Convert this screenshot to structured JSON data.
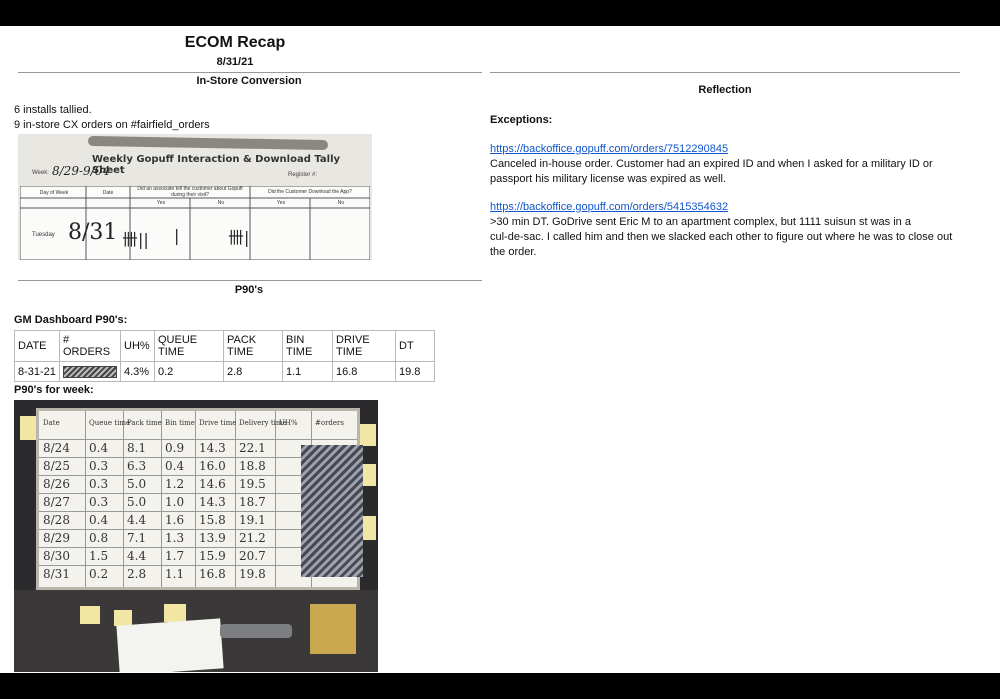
{
  "header": {
    "title": "ECOM Recap",
    "date": "8/31/21"
  },
  "in_store": {
    "heading": "In-Store Conversion",
    "lines": [
      "6 installs tallied.",
      "9 in-store CX orders on #fairfield_orders"
    ],
    "photo": {
      "title": "Weekly Gopuff Interaction & Download Tally Sheet",
      "week_label": "Week:",
      "week_value": "8/29-9/04",
      "register_label": "Register #:",
      "headers": [
        "Day of Week",
        "Date",
        "Did an associate tell the customer about Gopuff during their visit?",
        "Did the Customer Download the App?"
      ],
      "yes_no": [
        "Yes",
        "No",
        "Yes",
        "No"
      ],
      "day": "Tuesday",
      "date_hw": "8/31",
      "tally_yes": "卌||",
      "tally_no": "|",
      "tally_dl": "卌|"
    }
  },
  "p90": {
    "heading": "P90's",
    "dashboard_label": "GM Dashboard P90's:",
    "columns": [
      "DATE",
      "# ORDERS",
      "UH%",
      "QUEUE TIME",
      "PACK TIME",
      "BIN TIME",
      "DRIVE TIME",
      "DT"
    ],
    "row": [
      "8-31-21",
      "",
      "4.3%",
      "0.2",
      "2.8",
      "1.1",
      "16.8",
      "19.8"
    ],
    "week_label": "P90's for week:",
    "whiteboard": {
      "headers": [
        "Date",
        "Queue time",
        "Pack time",
        "Bin time",
        "Drive time",
        "Delivery time",
        "UH%",
        "#orders"
      ],
      "rows": [
        [
          "8/24",
          "0.4",
          "8.1",
          "0.9",
          "14.3",
          "22.1"
        ],
        [
          "8/25",
          "0.3",
          "6.3",
          "0.4",
          "16.0",
          "18.8"
        ],
        [
          "8/26",
          "0.3",
          "5.0",
          "1.2",
          "14.6",
          "19.5"
        ],
        [
          "8/27",
          "0.3",
          "5.0",
          "1.0",
          "14.3",
          "18.7"
        ],
        [
          "8/28",
          "0.4",
          "4.4",
          "1.6",
          "15.8",
          "19.1"
        ],
        [
          "8/29",
          "0.8",
          "7.1",
          "1.3",
          "13.9",
          "21.2"
        ],
        [
          "8/30",
          "1.5",
          "4.4",
          "1.7",
          "15.9",
          "20.7"
        ],
        [
          "8/31",
          "0.2",
          "2.8",
          "1.1",
          "16.8",
          "19.8"
        ]
      ]
    }
  },
  "reflection": {
    "heading": "Reflection",
    "exceptions_label": "Exceptions:",
    "items": [
      {
        "link": "https://backoffice.gopuff.com/orders/7512290845",
        "lines": [
          "Canceled in-house order. Customer had an expired ID and when I asked for a military ID or",
          "passport his military license was expired as well."
        ]
      },
      {
        "link": "https://backoffice.gopuff.com/orders/5415354632",
        "lines": [
          ">30 min DT. GoDrive sent Eric M to an apartment complex, but 1111 suisun st was in a",
          "cul-de-sac. I called him and then we slacked each other to figure out where he was to close out",
          "the order."
        ]
      }
    ]
  }
}
